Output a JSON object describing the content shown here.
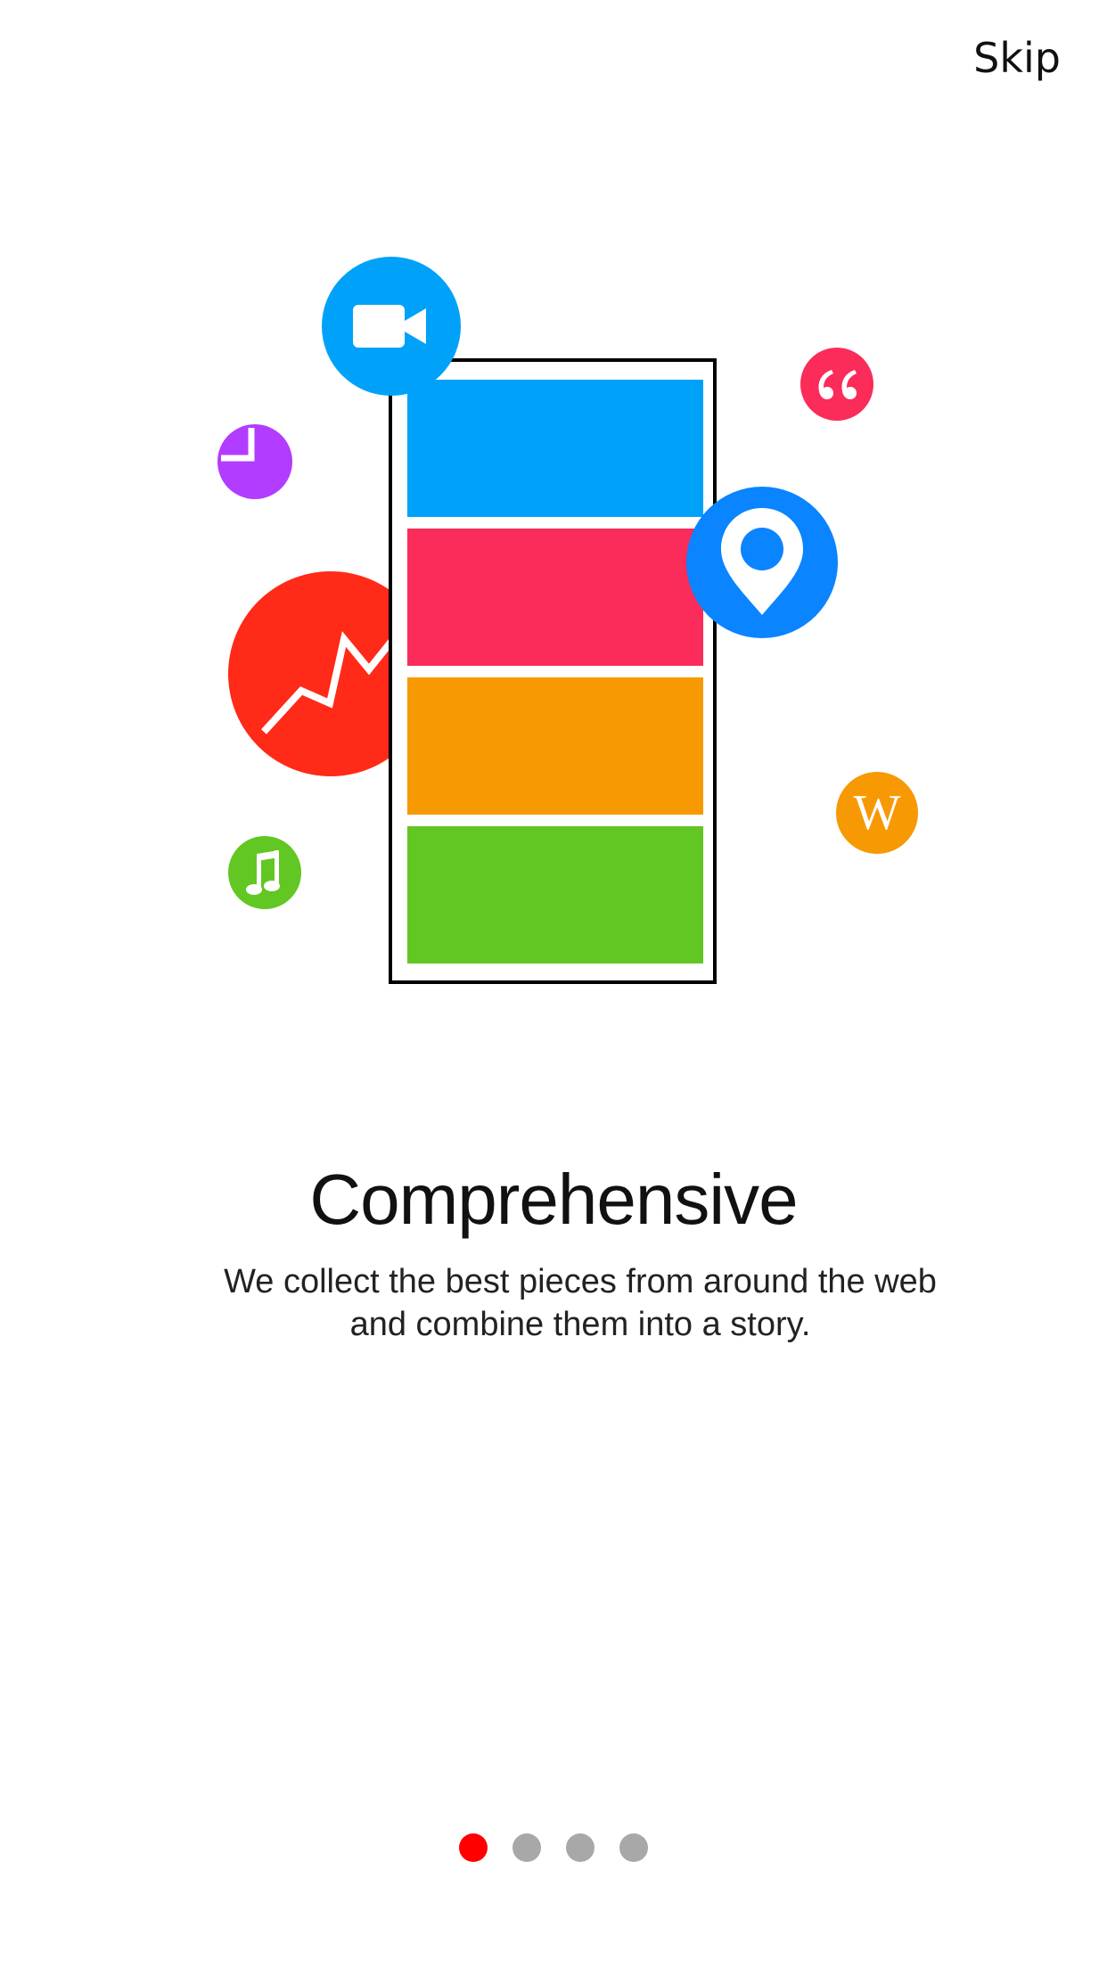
{
  "header": {
    "skip_label": "Skip"
  },
  "illustration": {
    "stripes": [
      {
        "name": "blue-stripe",
        "color": "#00A2F9"
      },
      {
        "name": "pink-stripe",
        "color": "#FB2B5A"
      },
      {
        "name": "orange-stripe",
        "color": "#F79903"
      },
      {
        "name": "green-stripe",
        "color": "#62C623"
      }
    ],
    "icons": [
      {
        "name": "video-camera-icon",
        "color": "#00A2F9"
      },
      {
        "name": "quote-icon",
        "color": "#FB2B5A"
      },
      {
        "name": "pie-chart-icon",
        "color": "#B23CFF"
      },
      {
        "name": "location-pin-icon",
        "color": "#0A84FF"
      },
      {
        "name": "stock-chart-icon",
        "color": "#FF2A18"
      },
      {
        "name": "wikipedia-icon",
        "color": "#F79903",
        "glyph": "W"
      },
      {
        "name": "music-note-icon",
        "color": "#62C623"
      }
    ]
  },
  "content": {
    "title": "Comprehensive",
    "subtitle_line1": "We collect the best pieces from around the web",
    "subtitle_line2": "and combine them into a story."
  },
  "pagination": {
    "total_pages": 4,
    "current_page": 1,
    "active_color": "#FF0000",
    "inactive_color": "#A8A8A8"
  }
}
